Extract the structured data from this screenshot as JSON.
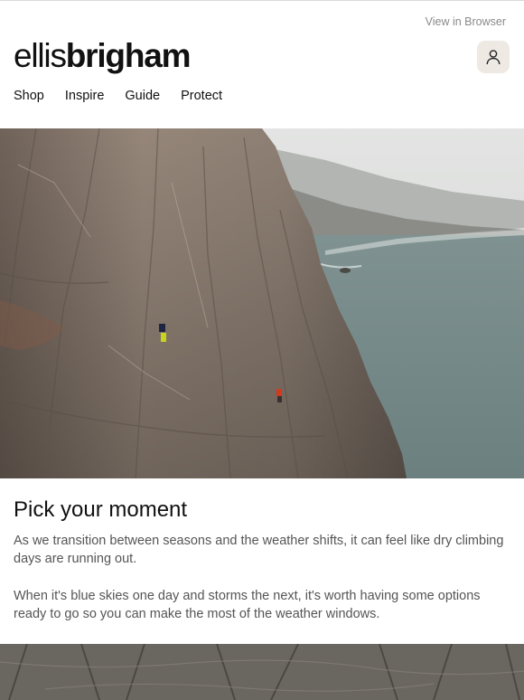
{
  "header": {
    "view_in_browser": "View in Browser",
    "logo_light": "ellis",
    "logo_bold": "brigham"
  },
  "nav": {
    "items": [
      "Shop",
      "Inspire",
      "Guide",
      "Protect"
    ]
  },
  "hero": {
    "icon": "sea-cliff-climbers-photo"
  },
  "content": {
    "heading": "Pick your moment",
    "paragraph1": "As we transition between seasons and the weather shifts, it can feel like dry climbing days are running out.",
    "paragraph2": "When it's blue skies one day and storms the next, it's worth having some options ready to go so you can make the most of the weather windows."
  },
  "colors": {
    "account_button_bg": "#efe9e4",
    "muted_text": "#8a8a8a",
    "body_text": "#555555",
    "heading_text": "#111111"
  }
}
